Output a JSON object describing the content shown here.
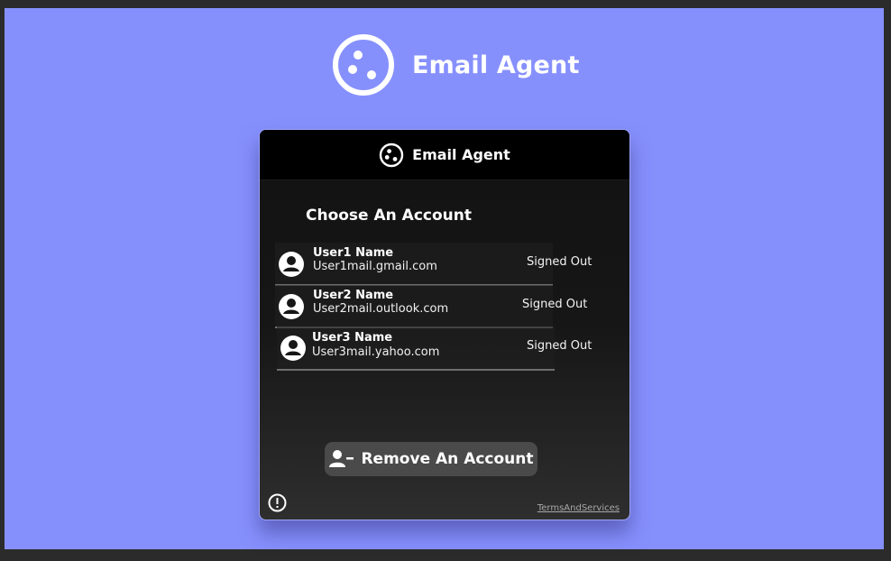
{
  "app": {
    "title": "Email Agent",
    "logo_icon": "email-agent-logo-icon"
  },
  "card": {
    "header_title": "Email Agent",
    "choose_title": "Choose An Account",
    "accounts": [
      {
        "name": "User1 Name",
        "email": "User1mail.gmail.com",
        "status": "Signed Out",
        "icon": "user-avatar-icon"
      },
      {
        "name": "User2 Name",
        "email": "User2mail.outlook.com",
        "status": "Signed Out",
        "icon": "user-avatar-icon"
      },
      {
        "name": "User3 Name",
        "email": "User3mail.yahoo.com",
        "status": "Signed Out",
        "icon": "user-avatar-icon"
      }
    ],
    "remove_button": {
      "label": "Remove An Account",
      "icon": "user-remove-icon"
    },
    "info_icon": "info-icon",
    "terms_link": "TermsAndServices"
  },
  "colors": {
    "page_background": "#8690fd",
    "outer_frame": "#2b2b2b",
    "card_header": "#000000",
    "button_background": "#4a4a4a",
    "text": "#ffffff",
    "link": "#a8a8a8"
  }
}
